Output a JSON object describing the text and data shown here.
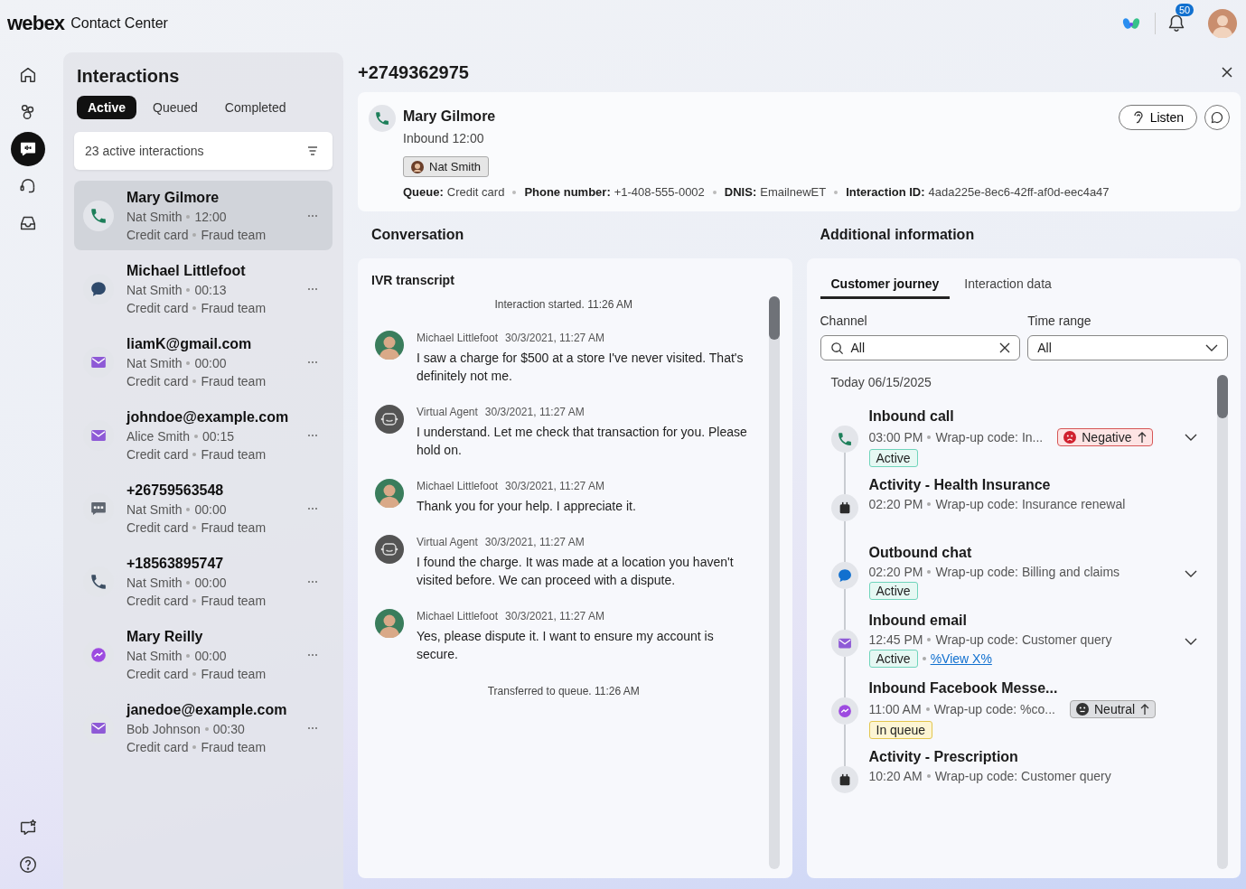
{
  "brand": {
    "logo": "webex",
    "product": "Contact Center"
  },
  "header": {
    "notification_count": "50"
  },
  "nav": {
    "top": [
      {
        "kind": "home",
        "selected": false
      },
      {
        "kind": "people",
        "selected": false
      },
      {
        "kind": "interactions",
        "selected": true
      },
      {
        "kind": "headset",
        "selected": false
      },
      {
        "kind": "inbox",
        "selected": false
      }
    ],
    "bottom": [
      {
        "kind": "feedback",
        "selected": false
      },
      {
        "kind": "help",
        "selected": false
      }
    ]
  },
  "interactions": {
    "title": "Interactions",
    "tabs": [
      {
        "label": "Active",
        "selected": true
      },
      {
        "label": "Queued",
        "selected": false
      },
      {
        "label": "Completed",
        "selected": false
      }
    ],
    "summary": "23 active interactions",
    "items": [
      {
        "kind": "phone",
        "title": "Mary Gilmore",
        "agent": "Nat Smith",
        "duration": "12:00",
        "queue": "Credit card",
        "team": "Fraud team",
        "selected": true
      },
      {
        "kind": "chat",
        "title": "Michael Littlefoot",
        "agent": "Nat Smith",
        "duration": "00:13",
        "queue": "Credit card",
        "team": "Fraud team",
        "selected": false
      },
      {
        "kind": "email",
        "title": "liamK@gmail.com",
        "agent": "Nat Smith",
        "duration": "00:00",
        "queue": "Credit card",
        "team": "Fraud team",
        "selected": false
      },
      {
        "kind": "email",
        "title": "johndoe@example.com",
        "agent": "Alice Smith",
        "duration": "00:15",
        "queue": "Credit card",
        "team": "Fraud team",
        "selected": false
      },
      {
        "kind": "sms",
        "title": "+26759563548",
        "agent": "Nat Smith",
        "duration": "00:00",
        "queue": "Credit card",
        "team": "Fraud team",
        "selected": false
      },
      {
        "kind": "phone",
        "title": "+18563895747",
        "agent": "Nat Smith",
        "duration": "00:00",
        "queue": "Credit card",
        "team": "Fraud team",
        "selected": false
      },
      {
        "kind": "messenger",
        "title": "Mary Reilly",
        "agent": "Nat Smith",
        "duration": "00:00",
        "queue": "Credit card",
        "team": "Fraud team",
        "selected": false
      },
      {
        "kind": "email",
        "title": "janedoe@example.com",
        "agent": "Bob Johnson",
        "duration": "00:30",
        "queue": "Credit card",
        "team": "Fraud team",
        "selected": false
      }
    ]
  },
  "detail": {
    "title": "+2749362975",
    "contact": {
      "kind": "phone",
      "name": "Mary Gilmore",
      "direction": "Inbound 12:00",
      "agent": "Nat Smith",
      "listen_button": "Listen",
      "fields": [
        {
          "label": "Queue:",
          "value": "Credit card"
        },
        {
          "label": "Phone number:",
          "value": "+1-408-555-0002"
        },
        {
          "label": "DNIS:",
          "value": "EmailnewET"
        },
        {
          "label": "Interaction ID:",
          "value": "4ada225e-8ec6-42ff-af0d-eec4a47"
        }
      ]
    }
  },
  "conversation": {
    "heading": "Conversation",
    "transcript_title": "IVR transcript",
    "entries": [
      {
        "kind": "event",
        "text": "Interaction started. 11:26 AM"
      },
      {
        "kind": "customer_message",
        "sender": "Michael Littlefoot",
        "time": "30/3/2021, 11:27 AM",
        "text": "I saw a charge for $500 at a store I've never visited. That's definitely not me."
      },
      {
        "kind": "bot_message",
        "sender": "Virtual Agent",
        "time": "30/3/2021, 11:27 AM",
        "text": "I understand. Let me check that transaction for you. Please hold on."
      },
      {
        "kind": "customer_message",
        "sender": "Michael Littlefoot",
        "time": "30/3/2021, 11:27 AM",
        "text": "Thank you for your help. I appreciate it."
      },
      {
        "kind": "bot_message",
        "sender": "Virtual Agent",
        "time": "30/3/2021, 11:27 AM",
        "text": "I found the charge. It was made at a location you haven't visited before. We can proceed with a dispute."
      },
      {
        "kind": "customer_message",
        "sender": "Michael Littlefoot",
        "time": "30/3/2021, 11:27 AM",
        "text": "Yes, please dispute it. I want to ensure my account is secure."
      },
      {
        "kind": "event",
        "text": "Transferred to queue. 11:26 AM"
      }
    ]
  },
  "additional": {
    "heading": "Additional information",
    "tabs": [
      {
        "label": "Customer journey",
        "selected": true
      },
      {
        "label": "Interaction data",
        "selected": false
      }
    ],
    "channel_filter": {
      "label": "Channel",
      "value": "All"
    },
    "time_range": {
      "label": "Time range",
      "value": "All"
    },
    "date": "Today 06/15/2025",
    "journey": [
      {
        "kind": "phone",
        "title": "Inbound call",
        "time": "03:00 PM",
        "wrap_up": "Wrap-up code: In...",
        "sentiment": {
          "kind": "negative",
          "label": "Negative"
        },
        "status": {
          "kind": "active",
          "label": "Active"
        },
        "expandable": true
      },
      {
        "kind": "calendar",
        "title": "Activity - Health Insurance",
        "time": "02:20 PM",
        "wrap_up": "Wrap-up code: Insurance renewal",
        "expandable": false
      },
      {
        "kind": "chat",
        "title": "Outbound chat",
        "time": "02:20 PM",
        "wrap_up": "Wrap-up code: Billing and claims",
        "status": {
          "kind": "active",
          "label": "Active"
        },
        "expandable": true
      },
      {
        "kind": "email",
        "title": "Inbound email",
        "time": "12:45 PM",
        "wrap_up": "Wrap-up code: Customer query",
        "status": {
          "kind": "active",
          "label": "Active"
        },
        "link": "%View X%",
        "expandable": true
      },
      {
        "kind": "messenger",
        "title": "Inbound Facebook Messe...",
        "time": "11:00 AM",
        "wrap_up": "Wrap-up code: %co...",
        "sentiment": {
          "kind": "neutral",
          "label": "Neutral"
        },
        "status": {
          "kind": "queued",
          "label": "In queue"
        },
        "expandable": false
      },
      {
        "kind": "calendar",
        "title": "Activity - Prescription",
        "time": "10:20 AM",
        "wrap_up": "Wrap-up code: Customer query",
        "expandable": false
      }
    ]
  }
}
